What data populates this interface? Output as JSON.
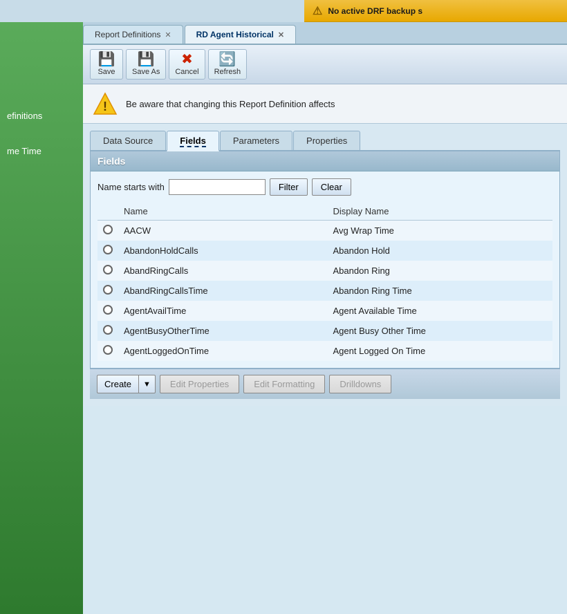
{
  "topWarning": {
    "icon": "⚠",
    "text": "No active DRF backup s"
  },
  "sidebar": {
    "item1": "efinitions",
    "item2": "me Time"
  },
  "tabs": [
    {
      "label": "Report Definitions",
      "active": false
    },
    {
      "label": "RD Agent Historical",
      "active": true
    }
  ],
  "toolbar": {
    "save_label": "Save",
    "save_as_label": "Save As",
    "cancel_label": "Cancel",
    "refresh_label": "Refresh"
  },
  "warningNotice": {
    "text": "Be aware that changing this Report Definition affects"
  },
  "innerTabs": [
    {
      "label": "Data Source",
      "active": false
    },
    {
      "label": "Fields",
      "active": true
    },
    {
      "label": "Parameters",
      "active": false
    },
    {
      "label": "Properties",
      "active": false
    }
  ],
  "fieldsPanel": {
    "header": "Fields",
    "filterLabel": "Name starts with",
    "filterPlaceholder": "",
    "filterBtn": "Filter",
    "clearBtn": "Clear",
    "columns": [
      "Name",
      "Display Name"
    ],
    "rows": [
      {
        "name": "AACW",
        "displayName": "Avg Wrap Time"
      },
      {
        "name": "AbandonHoldCalls",
        "displayName": "Abandon Hold"
      },
      {
        "name": "AbandRingCalls",
        "displayName": "Abandon Ring"
      },
      {
        "name": "AbandRingCallsTime",
        "displayName": "Abandon Ring Time"
      },
      {
        "name": "AgentAvailTime",
        "displayName": "Agent Available Time"
      },
      {
        "name": "AgentBusyOtherTime",
        "displayName": "Agent Busy Other Time"
      },
      {
        "name": "AgentLoggedOnTime",
        "displayName": "Agent Logged On Time"
      }
    ]
  },
  "bottomBar": {
    "createLabel": "Create",
    "editPropertiesLabel": "Edit Properties",
    "editFormattingLabel": "Edit Formatting",
    "drilldownsLabel": "Drilldowns"
  }
}
